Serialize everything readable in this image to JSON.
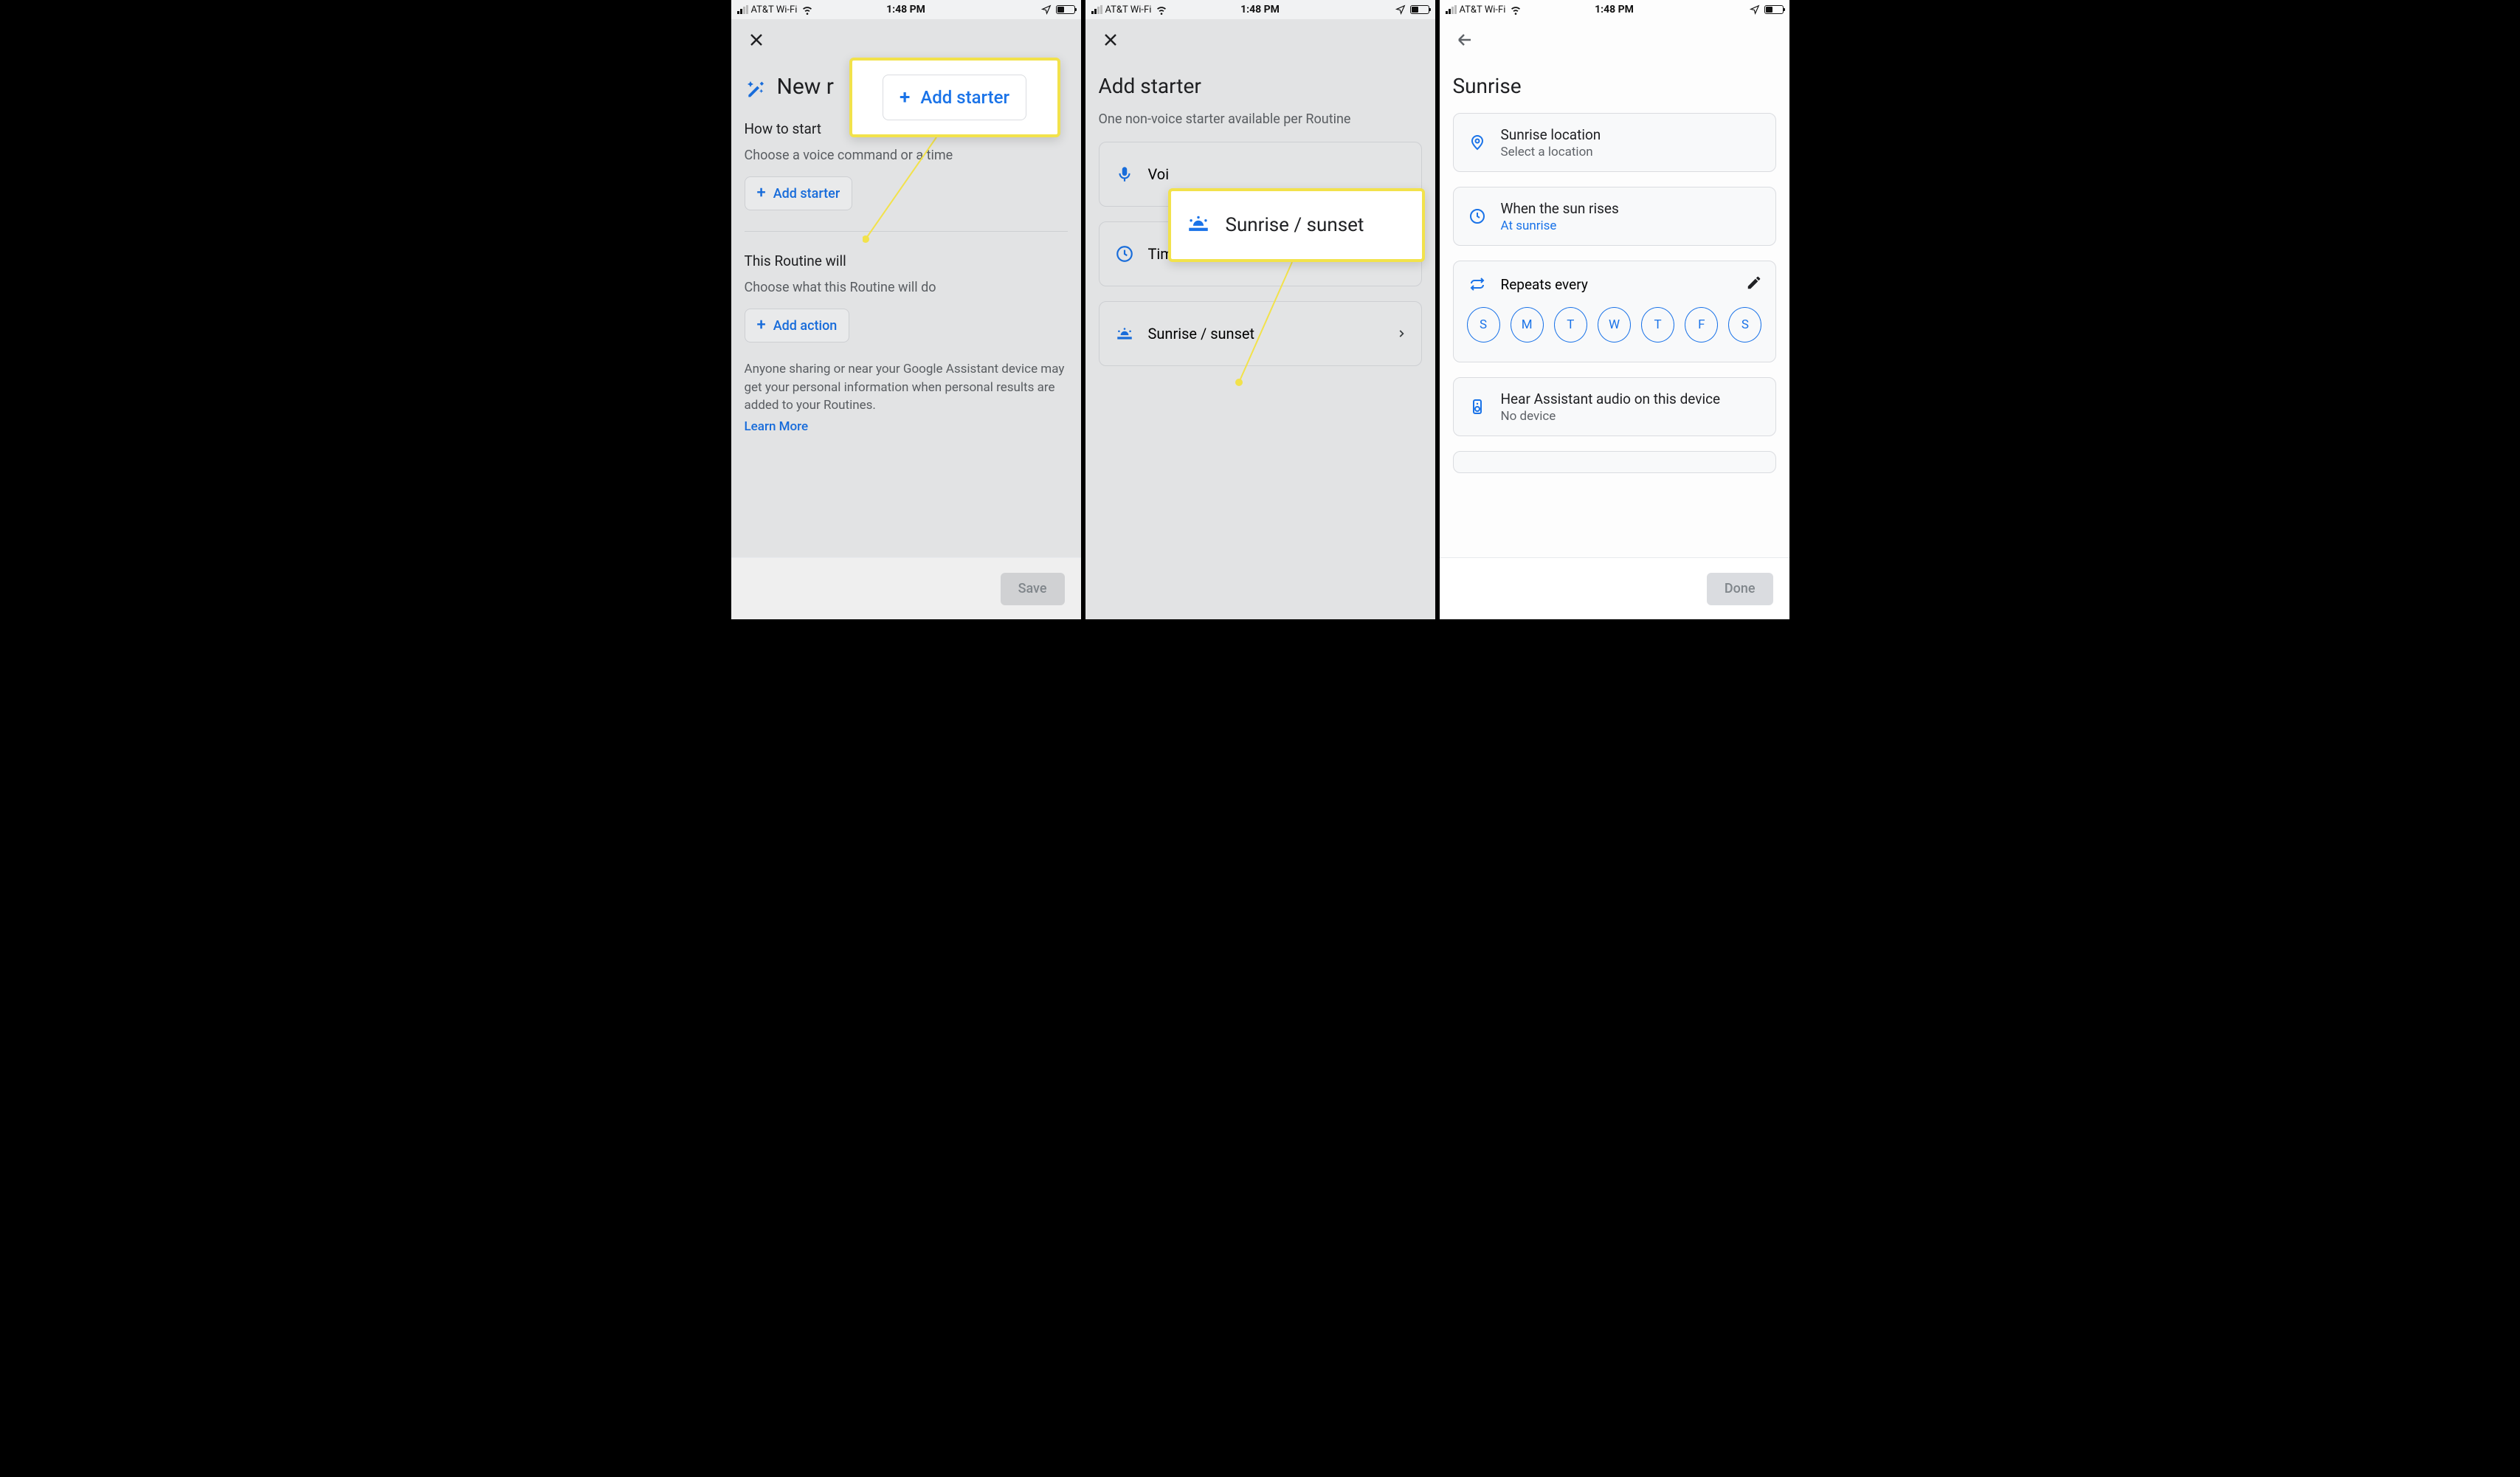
{
  "status": {
    "carrier": "AT&T Wi-Fi",
    "time": "1:48 PM"
  },
  "screen1": {
    "title": "New r",
    "howToStart": "How to start",
    "chooseVoice": "Choose a voice command or a time",
    "addStarter": "Add starter",
    "thisRoutineWill": "This Routine will",
    "chooseWhat": "Choose what this Routine will do",
    "addAction": "Add action",
    "disclosure": "Anyone sharing or near your Google Assistant device may get your personal information when personal results are added to your Routines.",
    "learnMore": "Learn More",
    "save": "Save",
    "callout_addStarter": "Add starter"
  },
  "screen2": {
    "title": "Add starter",
    "subtitle": "One non-voice starter available per Routine",
    "options": {
      "voice": "Voi",
      "time": "Time",
      "sun": "Sunrise / sunset"
    },
    "callout_sun": "Sunrise / sunset"
  },
  "screen3": {
    "title": "Sunrise",
    "location": {
      "title": "Sunrise location",
      "sub": "Select a location"
    },
    "when": {
      "title": "When the sun rises",
      "sub": "At sunrise"
    },
    "repeats": {
      "title": "Repeats every"
    },
    "days": [
      "S",
      "M",
      "T",
      "W",
      "T",
      "F",
      "S"
    ],
    "hear": {
      "title": "Hear Assistant audio on this device",
      "sub": "No device"
    },
    "done": "Done"
  }
}
